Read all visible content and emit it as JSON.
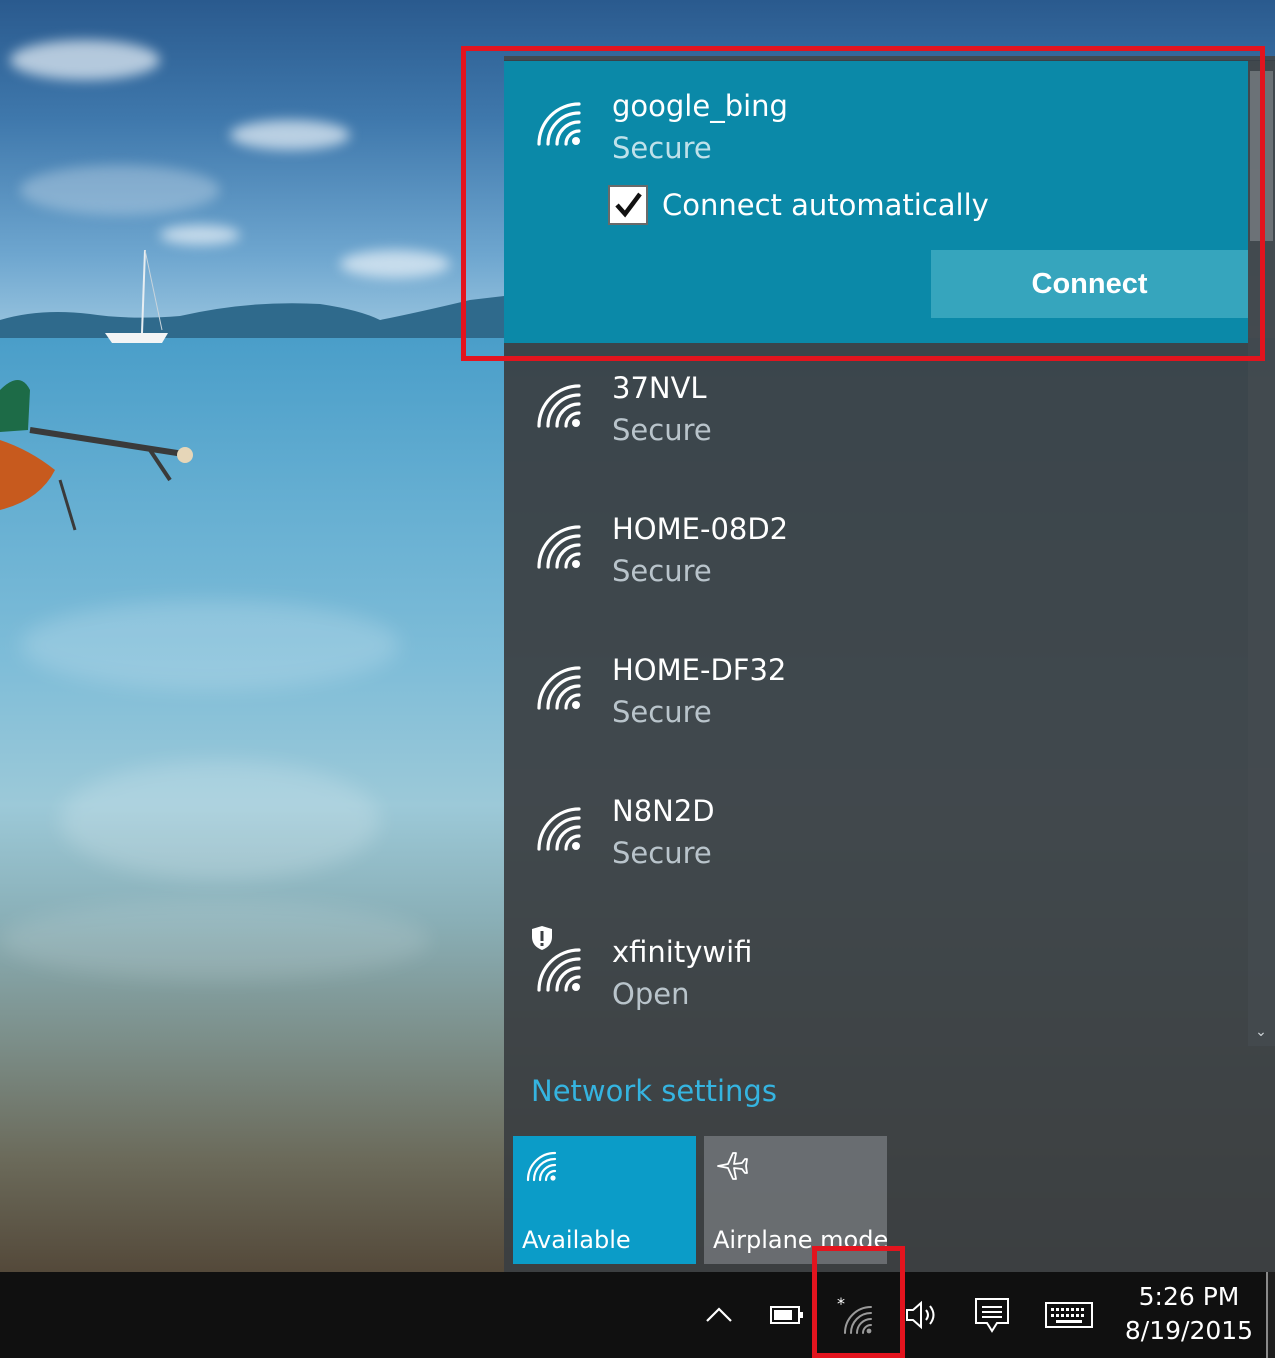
{
  "networks": [
    {
      "name": "google_bing",
      "status": "Secure",
      "selected": true,
      "shield": false
    },
    {
      "name": "37NVL",
      "status": "Secure"
    },
    {
      "name": "HOME-08D2",
      "status": "Secure"
    },
    {
      "name": "HOME-DF32",
      "status": "Secure"
    },
    {
      "name": "N8N2D",
      "status": "Secure"
    },
    {
      "name": "xfinitywifi",
      "status": "Open",
      "shield": true
    }
  ],
  "selected_network": {
    "connect_automatically_label": "Connect automatically",
    "connect_automatically_checked": true,
    "connect_button_label": "Connect"
  },
  "network_settings_link": "Network settings",
  "quick_actions": [
    {
      "label": "Available",
      "icon": "wifi-icon",
      "active": true
    },
    {
      "label": "Airplane mode",
      "icon": "airplane-icon",
      "active": false
    }
  ],
  "taskbar": {
    "time": "5:26 PM",
    "date": "8/19/2015",
    "icons": [
      "chevron-up-icon",
      "battery-icon",
      "wifi-tray-icon",
      "volume-icon",
      "action-center-icon",
      "keyboard-icon"
    ]
  },
  "colors": {
    "accent": "#0b89a8",
    "tile_active": "#0b9cc8",
    "link": "#35b4e0",
    "highlight": "#e3141e"
  }
}
